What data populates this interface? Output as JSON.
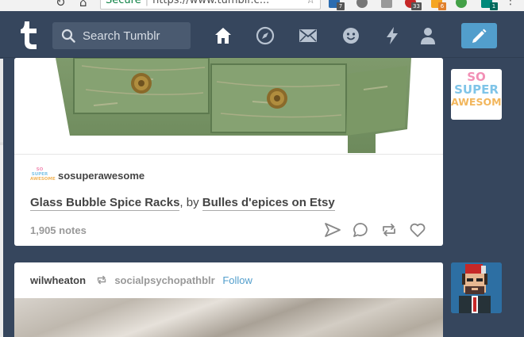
{
  "browser": {
    "secure_label": "Secure",
    "url": "https://www.tumblr.c...",
    "extension_badges": [
      "7",
      "33",
      "6",
      "1"
    ]
  },
  "header": {
    "search_placeholder": "Search Tumblr",
    "icons": [
      "tumblr-logo-icon",
      "search-icon",
      "home-icon",
      "explore-icon",
      "inbox-icon",
      "messaging-icon",
      "activity-icon",
      "account-icon",
      "compose-icon"
    ],
    "compose_color": "#529ecc",
    "bar_color": "#36465d"
  },
  "post1": {
    "blog_name": "sosuperawesome",
    "avatar_lines": [
      "SO",
      "SUPER",
      "AWESOME"
    ],
    "caption": {
      "title": "Glass Bubble Spice Racks",
      "separator": ", by ",
      "shop": "Bulles d'epices on Etsy"
    },
    "notes": "1,905 notes",
    "actions": [
      "share-icon",
      "reply-icon",
      "reblog-icon",
      "like-icon"
    ]
  },
  "post2": {
    "author": "wilwheaton",
    "source": "socialpsychopathblr",
    "follow_label": "Follow"
  },
  "sidebar_avatars": {
    "avatar1_lines": [
      "SO",
      "SUPER",
      "AWESOME"
    ]
  }
}
